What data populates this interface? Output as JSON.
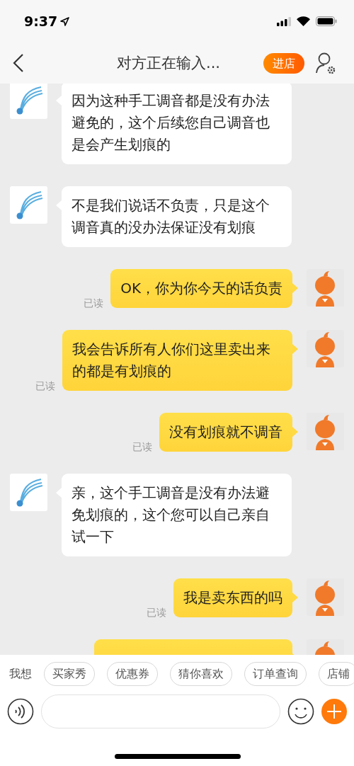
{
  "status_bar": {
    "time": "9:37"
  },
  "header": {
    "title": "对方正在输入...",
    "shop_button": "进店"
  },
  "messages": [
    {
      "kind": "incoming",
      "text": "因为这种手工调音都是没有办法避免的，这个后续您自己调音也是会产生划痕的"
    },
    {
      "kind": "incoming",
      "text": "不是我们说话不负责，只是这个调音真的没办法保证没有划痕"
    },
    {
      "kind": "outgoing",
      "text": "OK，你为你今天的话负责",
      "read_label": "已读"
    },
    {
      "kind": "outgoing",
      "text": "我会告诉所有人你们这里卖出来的都是有划痕的",
      "read_label": "已读"
    },
    {
      "kind": "outgoing",
      "text": "没有划痕就不调音",
      "read_label": "已读"
    },
    {
      "kind": "incoming",
      "text": "亲，这个手工调音是没有办法避免划痕的，这个您可以自己亲自试一下"
    },
    {
      "kind": "outgoing",
      "text": "我是卖东西的吗",
      "read_label": "已读"
    },
    {
      "kind": "outgoing"
    }
  ],
  "quick_replies": {
    "label": "我想",
    "chips": [
      "买家秀",
      "优惠券",
      "猜你喜欢",
      "订单查询",
      "店铺"
    ]
  }
}
